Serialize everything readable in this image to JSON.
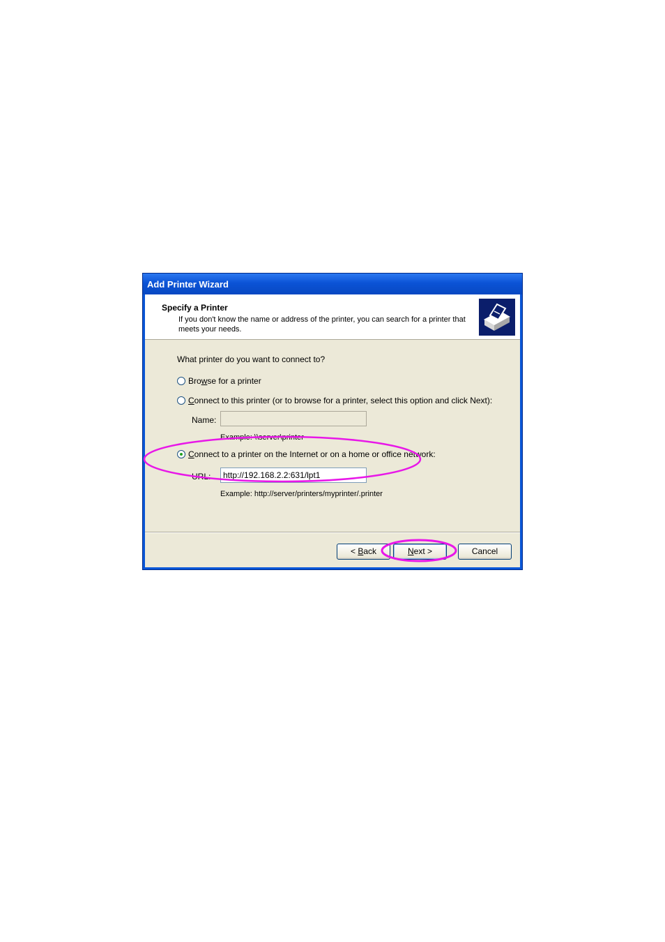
{
  "window": {
    "title": "Add Printer Wizard"
  },
  "header": {
    "title": "Specify a Printer",
    "description": "If you don't know the name or address of the printer, you can search for a printer that meets your needs.",
    "icon": "printer-wizard-icon"
  },
  "question": "What printer do you want to connect to?",
  "options": {
    "browse": {
      "pre": "Bro",
      "accel": "w",
      "post": "se for a printer",
      "checked": false
    },
    "connect_name": {
      "pre": "",
      "accel": "C",
      "post": "onnect to this printer (or to browse for a printer, select this option and click Next):",
      "checked": false
    },
    "connect_url": {
      "pre": "",
      "accel": "C",
      "post": "onnect to a printer on the Internet or on a home or office network:",
      "checked": true
    }
  },
  "name_field": {
    "label": "Name:",
    "value": "",
    "example": "Example: \\\\server\\printer"
  },
  "url_field": {
    "label": "URL:",
    "value": "http://192.168.2.2:631/lpt1",
    "example": "Example: http://server/printers/myprinter/.printer"
  },
  "buttons": {
    "back": {
      "prefix": "< ",
      "accel": "B",
      "rest": "ack"
    },
    "next": {
      "accel": "N",
      "rest": "ext >"
    },
    "cancel": "Cancel"
  },
  "colors": {
    "annotation": "#e817e8",
    "titlebar": "#0b53d6",
    "client": "#ece9d8"
  }
}
